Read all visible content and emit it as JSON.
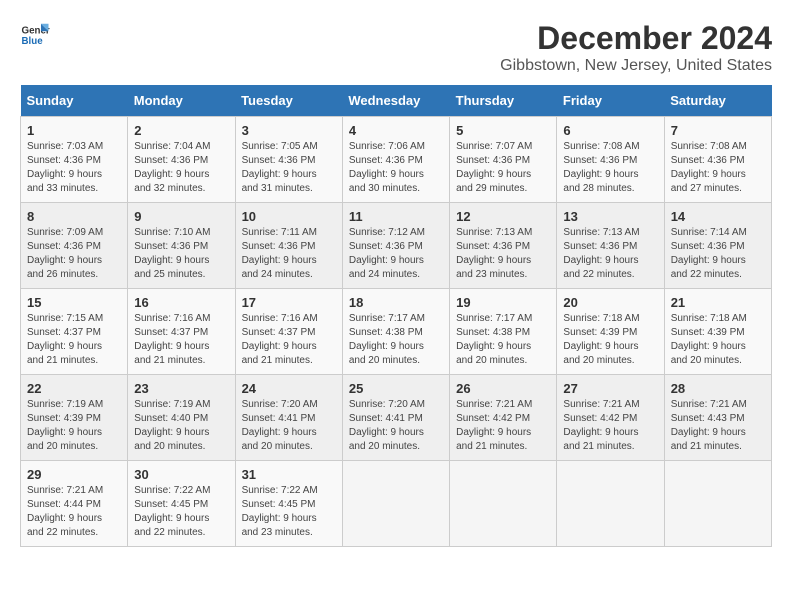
{
  "logo": {
    "line1": "General",
    "line2": "Blue"
  },
  "title": "December 2024",
  "subtitle": "Gibbstown, New Jersey, United States",
  "days_of_week": [
    "Sunday",
    "Monday",
    "Tuesday",
    "Wednesday",
    "Thursday",
    "Friday",
    "Saturday"
  ],
  "weeks": [
    [
      {
        "day": "1",
        "sunrise": "7:03 AM",
        "sunset": "4:36 PM",
        "daylight": "9 hours and 33 minutes."
      },
      {
        "day": "2",
        "sunrise": "7:04 AM",
        "sunset": "4:36 PM",
        "daylight": "9 hours and 32 minutes."
      },
      {
        "day": "3",
        "sunrise": "7:05 AM",
        "sunset": "4:36 PM",
        "daylight": "9 hours and 31 minutes."
      },
      {
        "day": "4",
        "sunrise": "7:06 AM",
        "sunset": "4:36 PM",
        "daylight": "9 hours and 30 minutes."
      },
      {
        "day": "5",
        "sunrise": "7:07 AM",
        "sunset": "4:36 PM",
        "daylight": "9 hours and 29 minutes."
      },
      {
        "day": "6",
        "sunrise": "7:08 AM",
        "sunset": "4:36 PM",
        "daylight": "9 hours and 28 minutes."
      },
      {
        "day": "7",
        "sunrise": "7:08 AM",
        "sunset": "4:36 PM",
        "daylight": "9 hours and 27 minutes."
      }
    ],
    [
      {
        "day": "8",
        "sunrise": "7:09 AM",
        "sunset": "4:36 PM",
        "daylight": "9 hours and 26 minutes."
      },
      {
        "day": "9",
        "sunrise": "7:10 AM",
        "sunset": "4:36 PM",
        "daylight": "9 hours and 25 minutes."
      },
      {
        "day": "10",
        "sunrise": "7:11 AM",
        "sunset": "4:36 PM",
        "daylight": "9 hours and 24 minutes."
      },
      {
        "day": "11",
        "sunrise": "7:12 AM",
        "sunset": "4:36 PM",
        "daylight": "9 hours and 24 minutes."
      },
      {
        "day": "12",
        "sunrise": "7:13 AM",
        "sunset": "4:36 PM",
        "daylight": "9 hours and 23 minutes."
      },
      {
        "day": "13",
        "sunrise": "7:13 AM",
        "sunset": "4:36 PM",
        "daylight": "9 hours and 22 minutes."
      },
      {
        "day": "14",
        "sunrise": "7:14 AM",
        "sunset": "4:36 PM",
        "daylight": "9 hours and 22 minutes."
      }
    ],
    [
      {
        "day": "15",
        "sunrise": "7:15 AM",
        "sunset": "4:37 PM",
        "daylight": "9 hours and 21 minutes."
      },
      {
        "day": "16",
        "sunrise": "7:16 AM",
        "sunset": "4:37 PM",
        "daylight": "9 hours and 21 minutes."
      },
      {
        "day": "17",
        "sunrise": "7:16 AM",
        "sunset": "4:37 PM",
        "daylight": "9 hours and 21 minutes."
      },
      {
        "day": "18",
        "sunrise": "7:17 AM",
        "sunset": "4:38 PM",
        "daylight": "9 hours and 20 minutes."
      },
      {
        "day": "19",
        "sunrise": "7:17 AM",
        "sunset": "4:38 PM",
        "daylight": "9 hours and 20 minutes."
      },
      {
        "day": "20",
        "sunrise": "7:18 AM",
        "sunset": "4:39 PM",
        "daylight": "9 hours and 20 minutes."
      },
      {
        "day": "21",
        "sunrise": "7:18 AM",
        "sunset": "4:39 PM",
        "daylight": "9 hours and 20 minutes."
      }
    ],
    [
      {
        "day": "22",
        "sunrise": "7:19 AM",
        "sunset": "4:39 PM",
        "daylight": "9 hours and 20 minutes."
      },
      {
        "day": "23",
        "sunrise": "7:19 AM",
        "sunset": "4:40 PM",
        "daylight": "9 hours and 20 minutes."
      },
      {
        "day": "24",
        "sunrise": "7:20 AM",
        "sunset": "4:41 PM",
        "daylight": "9 hours and 20 minutes."
      },
      {
        "day": "25",
        "sunrise": "7:20 AM",
        "sunset": "4:41 PM",
        "daylight": "9 hours and 20 minutes."
      },
      {
        "day": "26",
        "sunrise": "7:21 AM",
        "sunset": "4:42 PM",
        "daylight": "9 hours and 21 minutes."
      },
      {
        "day": "27",
        "sunrise": "7:21 AM",
        "sunset": "4:42 PM",
        "daylight": "9 hours and 21 minutes."
      },
      {
        "day": "28",
        "sunrise": "7:21 AM",
        "sunset": "4:43 PM",
        "daylight": "9 hours and 21 minutes."
      }
    ],
    [
      {
        "day": "29",
        "sunrise": "7:21 AM",
        "sunset": "4:44 PM",
        "daylight": "9 hours and 22 minutes."
      },
      {
        "day": "30",
        "sunrise": "7:22 AM",
        "sunset": "4:45 PM",
        "daylight": "9 hours and 22 minutes."
      },
      {
        "day": "31",
        "sunrise": "7:22 AM",
        "sunset": "4:45 PM",
        "daylight": "9 hours and 23 minutes."
      },
      null,
      null,
      null,
      null
    ]
  ],
  "labels": {
    "sunrise": "Sunrise:",
    "sunset": "Sunset:",
    "daylight": "Daylight:"
  }
}
